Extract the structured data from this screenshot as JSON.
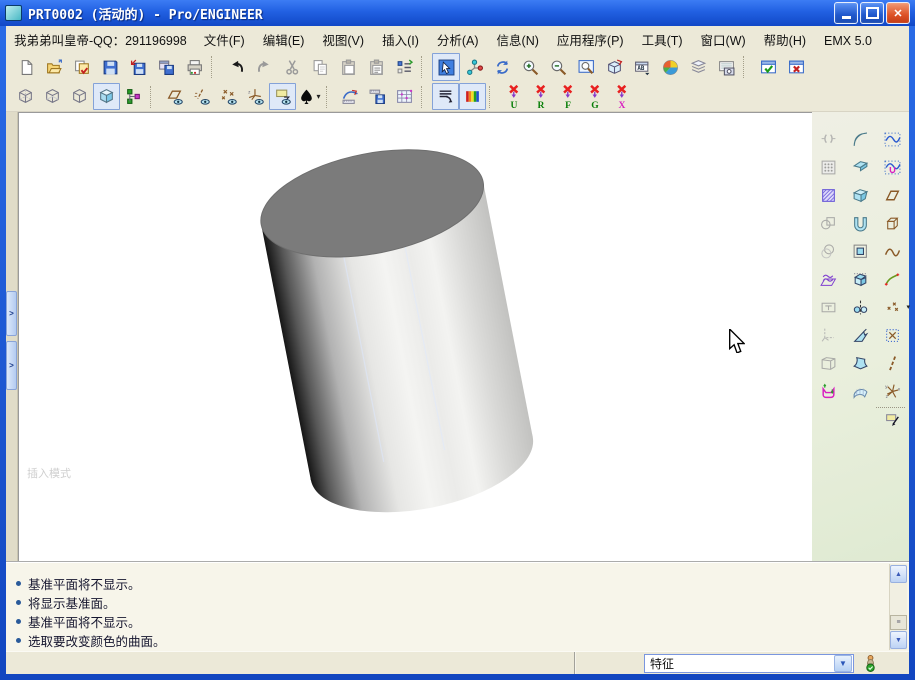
{
  "window": {
    "title": "PRT0002 (活动的) - Pro/ENGINEER",
    "controls": [
      "minimize",
      "maximize",
      "close"
    ]
  },
  "menu": {
    "user_text": "我弟弟叫皇帝-QQ：291196998",
    "items": [
      "文件(F)",
      "编辑(E)",
      "视图(V)",
      "插入(I)",
      "分析(A)",
      "信息(N)",
      "应用程序(P)",
      "工具(T)",
      "窗口(W)",
      "帮助(H)",
      "EMX 5.0"
    ]
  },
  "toolbars": {
    "row1": [
      [
        "new",
        "open",
        "save-session",
        "save",
        "save-as",
        "backup",
        "print"
      ],
      [
        "undo",
        "redo",
        "cut",
        "copy",
        "paste",
        "paste-list",
        "update"
      ],
      [
        "select*",
        "spin-center",
        "redraw",
        "zoom-in",
        "zoom-out",
        "refit",
        "reorient",
        "saved-views",
        "appearance",
        "layers",
        "capture"
      ],
      [
        "activate-window",
        "close-window"
      ]
    ],
    "row2": [
      [
        "wireframe",
        "hidden-line",
        "no-hidden",
        "shaded*",
        "model-tree"
      ],
      [
        "datum-planes",
        "datum-axes",
        "datum-points",
        "datum-csys",
        "annotations*",
        "spade^"
      ],
      [
        "analysis",
        "saved-analyses",
        "mesh-surface"
      ],
      [
        "filter*",
        "colors*"
      ],
      [
        "sim-U",
        "sim-R",
        "sim-F",
        "sim-G",
        "sim-X"
      ]
    ],
    "sim_letters": [
      "U",
      "R",
      "F",
      "G",
      "X"
    ]
  },
  "sidebar": {
    "rows": [
      [
        "~mirror",
        "round",
        "style-curve"
      ],
      [
        "~pattern",
        "chamfer",
        "style-curve-u"
      ],
      [
        "hatch",
        "draft",
        "plane"
      ],
      [
        "~boolean",
        "rib",
        "extrude-frame"
      ],
      [
        "~circle2",
        "offset-surface",
        "curve"
      ],
      [
        "wavy",
        "extrude-cube",
        "curve-points"
      ],
      [
        "~textbox",
        "revolve",
        "points^"
      ],
      [
        "~axes",
        "sweep",
        "csys-dotted"
      ],
      [
        "~shell",
        "blend",
        "axis-dashed"
      ],
      [
        "magenta-u",
        "mesh-sheet",
        "csys-star"
      ],
      [
        null,
        null,
        "plane-drag"
      ]
    ]
  },
  "canvas": {
    "watermark": "插入模式"
  },
  "messages": [
    "基准平面将不显示。",
    "将显示基准面。",
    "基准平面将不显示。",
    "选取要改变颜色的曲面。"
  ],
  "statusbar": {
    "selector_value": "特征"
  },
  "colors": {
    "titlebar_blue": "#2160e2",
    "panel_beige": "#ece9d8",
    "pressed_bg": "#dfe9f8",
    "pressed_border": "#84a2d8",
    "message_bullet": "#2a5a9a",
    "close_button": "#dd5226",
    "cylinder_top": "#7b7b7b"
  }
}
